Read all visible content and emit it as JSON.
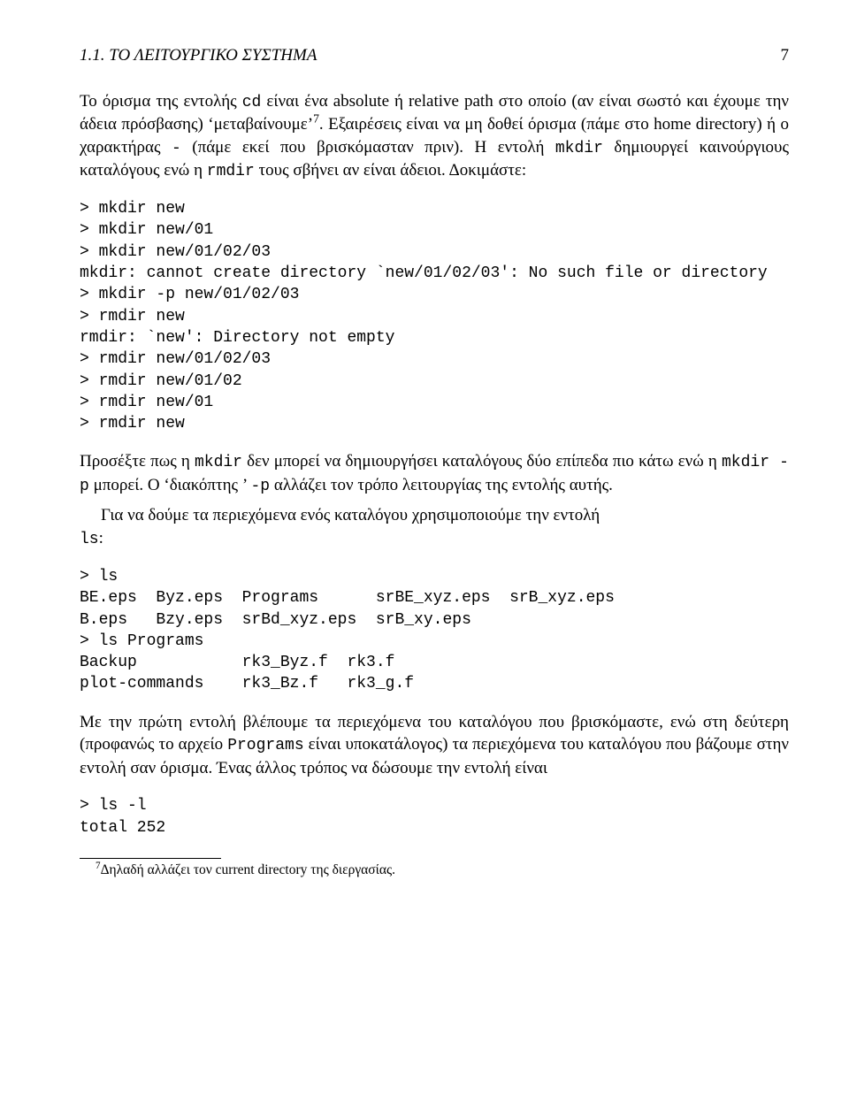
{
  "header": {
    "section_number": "1.1.",
    "section_title": "ΤΟ ΛΕΙΤΟΥΡΓΙΚΟ ΣΥΣΤΗΜΑ",
    "page_number": "7"
  },
  "para1": {
    "t1": "Το όρισμα της εντολής ",
    "c1": "cd",
    "t2": " είναι ένα absolute ή relative path στο οποίο (αν είναι σωστό και έχουμε την άδεια πρόσβασης) ‘μεταβαίνουμε’",
    "sup": "7",
    "t3": ". Εξαιρέσεις είναι να μη δοθεί όρισμα (πάμε στο home directory) ή ο χαρακτήρας ",
    "c2": "-",
    "t4": " (πάμε εκεί που βρισκόμασταν πριν). Η εντολή ",
    "c3": "mkdir",
    "t5": " δημιουργεί καινούργιους καταλόγους ενώ η ",
    "c4": "rmdir",
    "t6": " τους σβήνει αν είναι άδειοι. Δοκιμάστε:"
  },
  "code1": "> mkdir new\n> mkdir new/01\n> mkdir new/01/02/03\nmkdir: cannot create directory `new/01/02/03': No such file or directory\n> mkdir -p new/01/02/03\n> rmdir new\nrmdir: `new': Directory not empty\n> rmdir new/01/02/03\n> rmdir new/01/02\n> rmdir new/01\n> rmdir new",
  "para2": {
    "t1": "Προσέξτε πως η ",
    "c1": "mkdir",
    "t2": " δεν μπορεί να δημιουργήσει καταλόγους δύο επίπεδα πιο κάτω ενώ η ",
    "c2": "mkdir -p",
    "t3": " μπορεί. Ο ‘διακόπτης ’ ",
    "c3": "-p",
    "t4": " αλλάζει τον τρόπο λειτουργίας της εντολής αυτής."
  },
  "para3": {
    "t1": "Για να δούμε τα περιεχόμενα ενός καταλόγου χρησιμοποιούμε την εντολή ",
    "c1": "ls",
    "t2": ":"
  },
  "code2": "> ls\nBE.eps  Byz.eps  Programs      srBE_xyz.eps  srB_xyz.eps\nB.eps   Bzy.eps  srBd_xyz.eps  srB_xy.eps\n> ls Programs\nBackup           rk3_Byz.f  rk3.f\nplot-commands    rk3_Bz.f   rk3_g.f",
  "para4": {
    "t1": "Με την πρώτη εντολή βλέπουμε τα περιεχόμενα του καταλόγου που βρισκόμαστε, ενώ στη δεύτερη (προφανώς το αρχείο ",
    "c1": "Programs",
    "t2": " είναι υποκατάλογος) τα περιεχόμενα του καταλόγου που βάζουμε στην εντολή σαν όρισμα. Ένας άλλος τρόπος να δώσουμε την εντολή είναι"
  },
  "code3": "> ls -l\ntotal 252",
  "footnote": {
    "num": "7",
    "text": "Δηλαδή αλλάζει τον current directory της διεργασίας."
  }
}
